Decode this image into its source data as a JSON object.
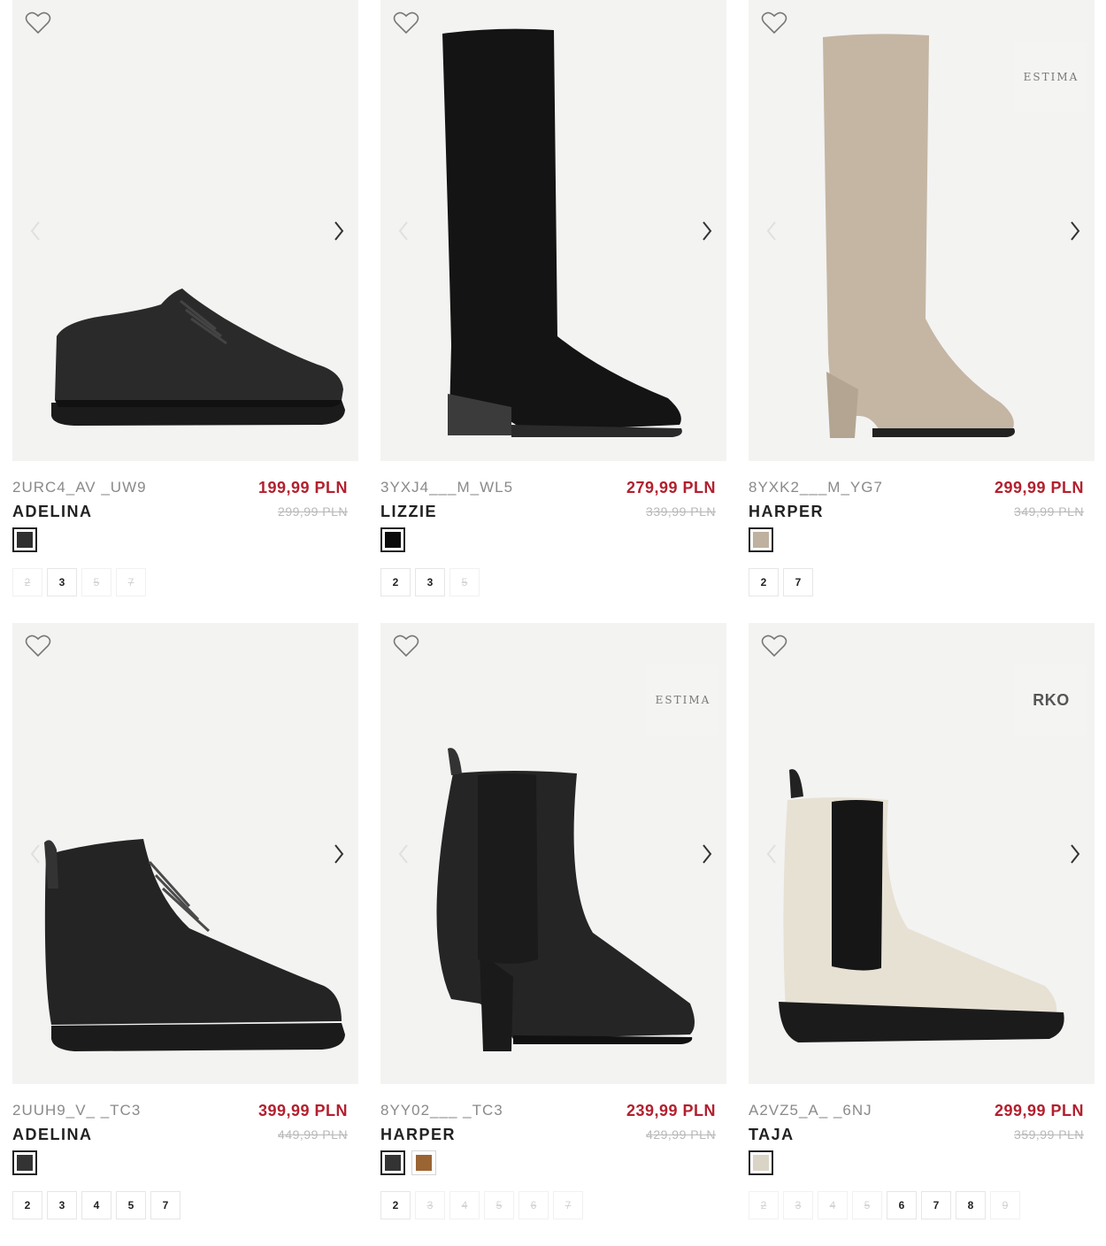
{
  "products": [
    {
      "code": "2URC4_AV _UW9",
      "name": "ADELINA",
      "price": "199,99 PLN",
      "old_price": "299,99 PLN",
      "brand": "",
      "colors": [
        {
          "hex": "#2f2f2f",
          "selected": true
        }
      ],
      "sizes": [
        {
          "label": "2",
          "available": false
        },
        {
          "label": "3",
          "available": true
        },
        {
          "label": "5",
          "available": false
        },
        {
          "label": "7",
          "available": false
        }
      ],
      "image_icon": "shoe-image"
    },
    {
      "code": "3YXJ4___M_WL5",
      "name": "LIZZIE",
      "price": "279,99 PLN",
      "old_price": "339,99 PLN",
      "brand": "",
      "colors": [
        {
          "hex": "#0a0a0a",
          "selected": true
        }
      ],
      "sizes": [
        {
          "label": "2",
          "available": true
        },
        {
          "label": "3",
          "available": true
        },
        {
          "label": "5",
          "available": false
        }
      ],
      "image_icon": "boot-image"
    },
    {
      "code": "8YXK2___M_YG7",
      "name": "HARPER",
      "price": "299,99 PLN",
      "old_price": "349,99 PLN",
      "brand": "ESTIMA",
      "colors": [
        {
          "hex": "#bfb19f",
          "selected": true
        }
      ],
      "sizes": [
        {
          "label": "2",
          "available": true
        },
        {
          "label": "7",
          "available": true
        }
      ],
      "image_icon": "boot-image"
    },
    {
      "code": "2UUH9_V_ _TC3",
      "name": "ADELINA",
      "price": "399,99 PLN",
      "old_price": "449,99 PLN",
      "brand": "",
      "colors": [
        {
          "hex": "#333333",
          "selected": true
        }
      ],
      "sizes": [
        {
          "label": "2",
          "available": true
        },
        {
          "label": "3",
          "available": true
        },
        {
          "label": "4",
          "available": true
        },
        {
          "label": "5",
          "available": true
        },
        {
          "label": "7",
          "available": true
        }
      ],
      "image_icon": "boot-image"
    },
    {
      "code": "8YY02___ _TC3",
      "name": "HARPER",
      "price": "239,99 PLN",
      "old_price": "429,99 PLN",
      "brand": "ESTIMA",
      "colors": [
        {
          "hex": "#333333",
          "selected": true
        },
        {
          "hex": "#9b6433",
          "selected": false
        }
      ],
      "sizes": [
        {
          "label": "2",
          "available": true
        },
        {
          "label": "3",
          "available": false
        },
        {
          "label": "4",
          "available": false
        },
        {
          "label": "5",
          "available": false
        },
        {
          "label": "6",
          "available": false
        },
        {
          "label": "7",
          "available": false
        }
      ],
      "image_icon": "boot-image"
    },
    {
      "code": "A2VZ5_A_ _6NJ",
      "name": "TAJA",
      "price": "299,99 PLN",
      "old_price": "359,99 PLN",
      "brand": "RKO",
      "colors": [
        {
          "hex": "#d9d4c6",
          "selected": true
        }
      ],
      "sizes": [
        {
          "label": "2",
          "available": false
        },
        {
          "label": "3",
          "available": false
        },
        {
          "label": "4",
          "available": false
        },
        {
          "label": "5",
          "available": false
        },
        {
          "label": "6",
          "available": true
        },
        {
          "label": "7",
          "available": true
        },
        {
          "label": "8",
          "available": true
        },
        {
          "label": "9",
          "available": false
        }
      ],
      "image_icon": "boot-image"
    }
  ],
  "ui": {
    "heart_icon": "heart-outline-icon",
    "prev_icon": "chevron-left-icon",
    "next_icon": "chevron-right-icon",
    "colors": {
      "price_red": "#b3202e",
      "image_bg": "#f3f3f2"
    }
  }
}
